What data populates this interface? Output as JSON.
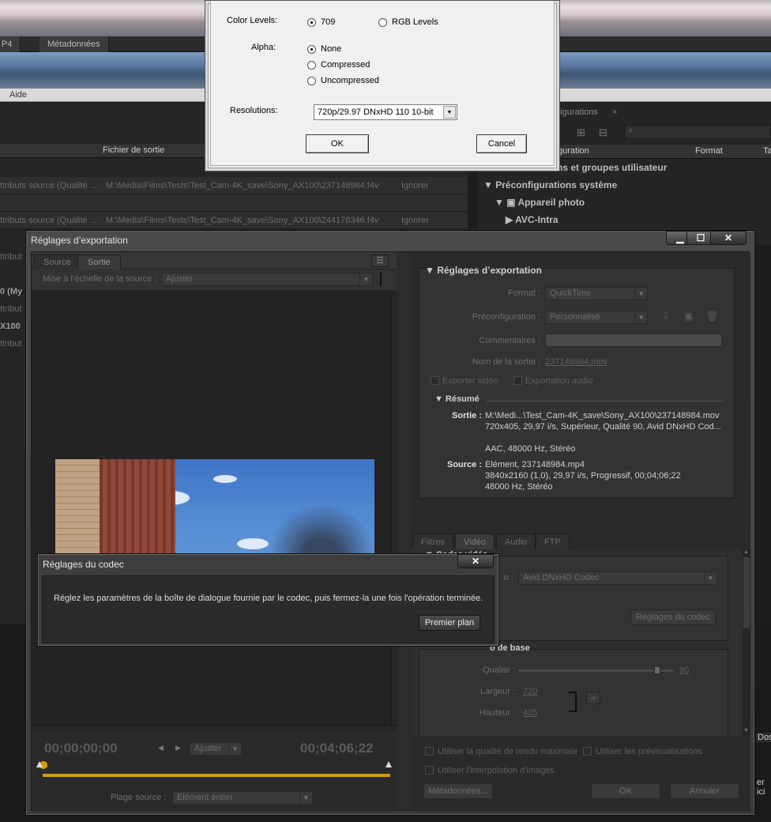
{
  "background": {
    "tabs": [
      "P4",
      "Métadonnées"
    ],
    "menu_help": "Aide",
    "queue_header": "Fichier de sortie",
    "queue_rows": [
      {
        "source": "ttributs source (Qualité ...",
        "path": "M:\\Media\\Films\\Tests\\Test_Cam-4K_save\\Sony_AX100\\237148984.f4v",
        "status": "Ignorer"
      },
      {
        "source": "ttributs source (Qualité ...",
        "path": "M:\\Media\\Films\\Tests\\Test_Cam-4K_save\\Sony_AX100\\244178346.f4v",
        "status": "Ignorer"
      }
    ],
    "queue_side_fragments": [
      "ttribut",
      "ttribut",
      "0 (My",
      "ttribut",
      "X100",
      "ttribut"
    ],
    "presets_tab": "nfigurations",
    "presets_col_name": "guration",
    "presets_col_format": "Format",
    "presets_col_t": "Ta",
    "presets_user_groups": "ns et groupes utilisateur",
    "presets_system": "Préconfigurations système",
    "presets_camera": "Appareil photo",
    "presets_avc": "AVC-Intra",
    "right_fragments": [
      "Dos",
      "er ici"
    ]
  },
  "avid_dialog": {
    "color_levels_label": "Color Levels:",
    "color_709": "709",
    "color_rgb": "RGB Levels",
    "alpha_label": "Alpha:",
    "alpha_none": "None",
    "alpha_compressed": "Compressed",
    "alpha_uncompressed": "Uncompressed",
    "resolutions_label": "Resolutions:",
    "resolution_value": "720p/29.97  DNxHD 110 10-bit",
    "ok": "OK",
    "cancel": "Cancel"
  },
  "export": {
    "title": "Réglages d’exportation",
    "tab_source": "Source",
    "tab_output": "Sortie",
    "scale_label": "Mise à l’échelle de la source :",
    "scale_value": "Ajuster",
    "tc_start": "00;00;00;00",
    "tc_end": "00;04;06;22",
    "fit_value": "Ajuster",
    "range_label": "Plage source :",
    "range_value": "Elément entier",
    "settings_title": "Réglages d’exportation",
    "format_label": "Format :",
    "format_value": "QuickTime",
    "preset_label": "Préconfiguration :",
    "preset_value": "Personnalisé",
    "comments_label": "Commentaires :",
    "output_name_label": "Nom de la sortie :",
    "output_name_value": "237148984.mov",
    "export_video": "Exporter vidéo",
    "export_audio": "Exportation audio",
    "summary_title": "Résumé",
    "output_key": "Sortie :",
    "output_lines": [
      "M:\\Medi...\\Test_Cam-4K_save\\Sony_AX100\\237148984.mov",
      "720x405, 29,97 i/s, Supérieur, Qualité 90, Avid DNxHD Cod...",
      "",
      "AAC, 48000 Hz, Stéréo"
    ],
    "source_key": "Source :",
    "source_lines": [
      "Elément, 237148984.mp4",
      "3840x2160 (1,0), 29,97 i/s, Progressif, 00;04;06;22",
      "48000 Hz, Stéréo"
    ],
    "tabs": [
      "Filtres",
      "Vidéo",
      "Audio",
      "FTP"
    ],
    "codec_section": "Codec vidéo",
    "codec_label_frag": "o :",
    "codec_value": "Avid DNxHD Codec",
    "codec_settings_btn": "Réglages du codec",
    "basic_section_frag": "o de base",
    "quality_label": "Qualité :",
    "quality_value": "90",
    "quality_level": 0.9,
    "width_label": "Largeur :",
    "width_value": "720",
    "height_label": "Hauteur :",
    "height_value": "405",
    "max_render": "Utiliser la qualité de rendu maximale",
    "use_previews": "Utiliser les prévisualisations",
    "frame_blend": "Utiliser l'interpolation d'images",
    "metadata_btn": "Métadonnées...",
    "ok_btn": "OK",
    "cancel_btn": "Annuler"
  },
  "codec_dialog": {
    "title": "Réglages du codec",
    "message": "Réglez les paramètres de la boîte de dialogue fournie par le codec, puis fermez-la une fois l'opération terminée.",
    "button": "Premier plan"
  }
}
